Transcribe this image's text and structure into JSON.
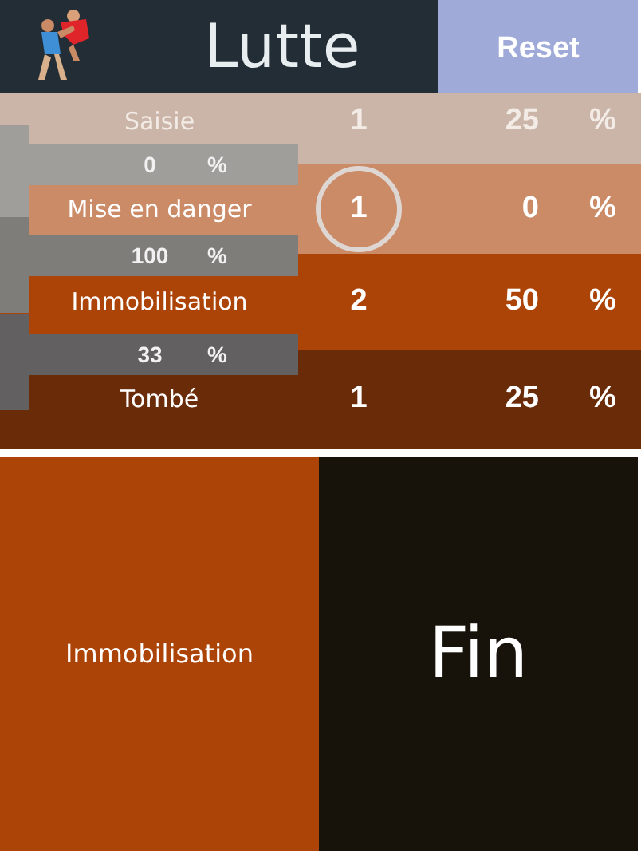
{
  "header": {
    "title": "Lutte",
    "reset_button": "Reset"
  },
  "rows": [
    {
      "label": "Saisie",
      "count": "1",
      "percent": "25",
      "unit": "%",
      "color": "#cbb5a8",
      "selected": false
    },
    {
      "label": "Mise en danger",
      "count": "1",
      "percent": "0",
      "unit": "%",
      "color": "#cb8b67",
      "selected": true
    },
    {
      "label": "Immobilisation",
      "count": "2",
      "percent": "50",
      "unit": "%",
      "color": "#ad4407",
      "selected": false
    },
    {
      "label": "Tombé",
      "count": "1",
      "percent": "25",
      "unit": "%",
      "color": "#692b08",
      "selected": false
    }
  ],
  "transitions": [
    {
      "percent": "0",
      "unit": "%",
      "color": "#a09e9b"
    },
    {
      "percent": "100",
      "unit": "%",
      "color": "#7f7d7a"
    },
    {
      "percent": "33",
      "unit": "%",
      "color": "#626060"
    }
  ],
  "result": {
    "label": "Immobilisation",
    "final": "Fin"
  }
}
